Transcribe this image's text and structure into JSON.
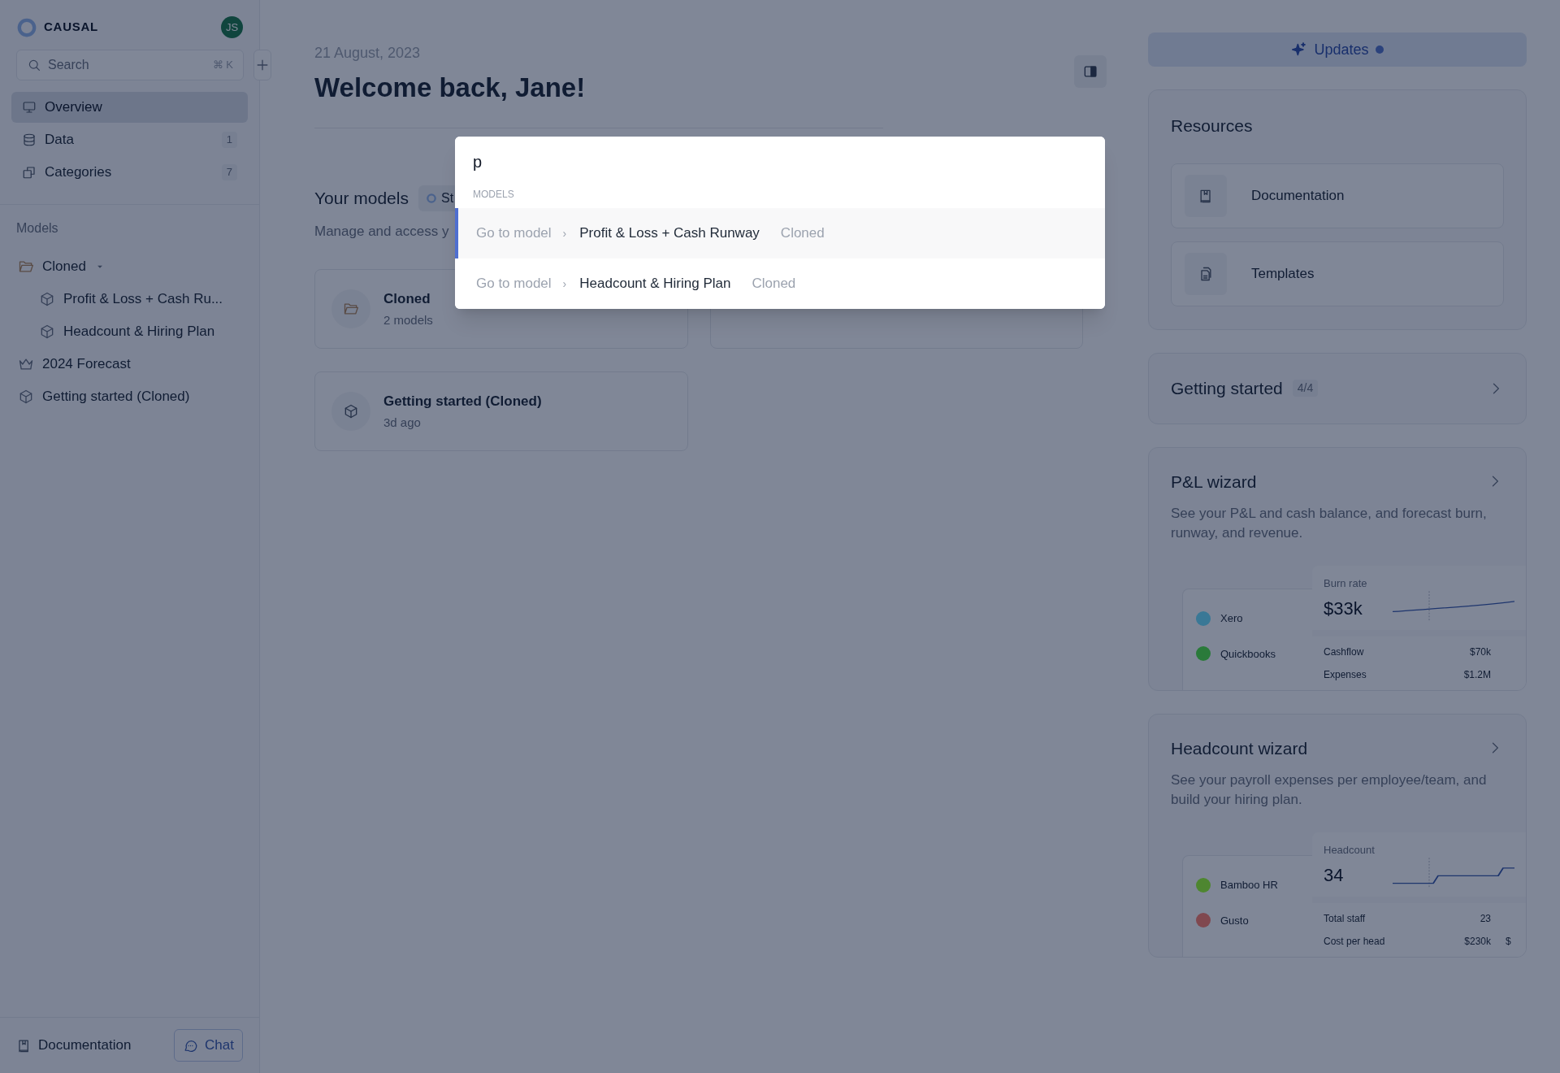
{
  "sidebar": {
    "logo": "CAUSAL",
    "avatar": "JS",
    "search": {
      "placeholder": "Search",
      "shortcut": "⌘ K"
    },
    "nav": [
      {
        "label": "Overview",
        "selected": true
      },
      {
        "label": "Data",
        "count": "1",
        "selected": false
      },
      {
        "label": "Categories",
        "count": "7",
        "selected": false
      }
    ],
    "models_heading": "Models",
    "models": [
      {
        "label": "Cloned",
        "kind": "folder",
        "expanded": true,
        "children": [
          {
            "label": "Profit & Loss + Cash Ru...",
            "kind": "model"
          },
          {
            "label": "Headcount & Hiring Plan",
            "kind": "model"
          }
        ]
      },
      {
        "label": "2024 Forecast",
        "kind": "crown"
      },
      {
        "label": "Getting started (Cloned)",
        "kind": "model"
      }
    ],
    "footer": {
      "documentation": "Documentation",
      "chat": "Chat"
    }
  },
  "main": {
    "date": "21 August, 2023",
    "title": "Welcome back, Jane!",
    "section_title": "Your models",
    "tab_partial": "St",
    "subtitle": "Manage and access y",
    "cards": [
      {
        "kind": "folder",
        "title": "Cloned",
        "subtitle": "2 models"
      },
      {
        "kind": "blank"
      },
      {
        "kind": "model",
        "title": "Getting started (Cloned)",
        "subtitle": "3d ago"
      }
    ]
  },
  "command_palette": {
    "query": "p",
    "section": "MODELS",
    "results": [
      {
        "prefix": "Go to model",
        "separator": "›",
        "title": "Profit & Loss + Cash Runway",
        "tag": "Cloned",
        "selected": true
      },
      {
        "prefix": "Go to model",
        "separator": "›",
        "title": "Headcount & Hiring Plan",
        "tag": "Cloned",
        "selected": false
      }
    ]
  },
  "right": {
    "updates": {
      "label": "Updates",
      "unread": true
    },
    "resources": {
      "title": "Resources",
      "items": [
        {
          "label": "Documentation"
        },
        {
          "label": "Templates"
        }
      ]
    },
    "getting_started": {
      "title": "Getting started",
      "progress": "4/4"
    },
    "wizards": [
      {
        "title": "P&L wizard",
        "description": "See your P&L and cash balance, and forecast burn, runway, and revenue.",
        "preview": {
          "integrations": [
            {
              "name": "Xero",
              "color": "#3a7896"
            },
            {
              "name": "Quickbooks",
              "color": "#2a7a3a"
            }
          ],
          "metric_label": "Burn rate",
          "metric_value": "$33k",
          "rows": [
            {
              "label": "Cashflow",
              "value": "$70k"
            },
            {
              "label": "Expenses",
              "value": "$1.2M"
            }
          ]
        }
      },
      {
        "title": "Headcount wizard",
        "description": "See your payroll expenses per employee/team, and build your hiring plan.",
        "preview": {
          "integrations": [
            {
              "name": "Bamboo HR",
              "color": "#4e8630"
            },
            {
              "name": "Gusto",
              "color": "#80484f"
            }
          ],
          "metric_label": "Headcount",
          "metric_value": "34",
          "rows": [
            {
              "label": "Total staff",
              "value": "23"
            },
            {
              "label": "Cost per head",
              "value": "$230k",
              "extra": "$"
            }
          ]
        }
      }
    ]
  }
}
